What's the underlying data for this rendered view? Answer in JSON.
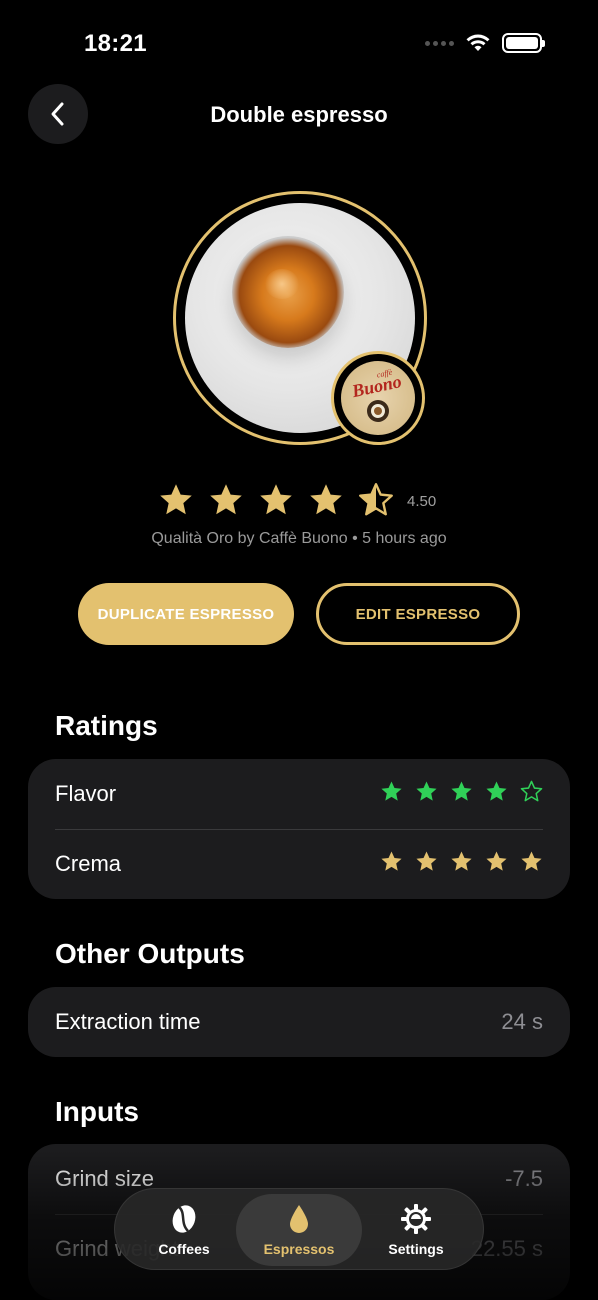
{
  "status_bar": {
    "time": "18:21"
  },
  "header": {
    "title": "Double espresso"
  },
  "hero": {
    "brand_logo_text": "caffè Buono"
  },
  "summary": {
    "rating": 4.5,
    "rating_label": "4.50",
    "subtitle": "Qualità Oro by Caffè Buono • 5 hours ago"
  },
  "actions": {
    "duplicate_label": "DUPLICATE ESPRESSO",
    "edit_label": "EDIT ESPRESSO"
  },
  "ratings_section": {
    "title": "Ratings",
    "items": [
      {
        "label": "Flavor",
        "stars": 4,
        "color": "#30d158"
      },
      {
        "label": "Crema",
        "stars": 5,
        "color": "#e3c16f"
      }
    ]
  },
  "outputs_section": {
    "title": "Other Outputs",
    "items": [
      {
        "label": "Extraction time",
        "value": "24 s"
      }
    ]
  },
  "inputs_section": {
    "title": "Inputs",
    "items": [
      {
        "label": "Grind size",
        "value": "-7.5"
      },
      {
        "label": "Grind weight",
        "value": "22.55 s"
      }
    ]
  },
  "tab_bar": {
    "tabs": [
      {
        "label": "Coffees",
        "icon": "coffee-bean-icon"
      },
      {
        "label": "Espressos",
        "icon": "drop-icon",
        "active": true
      },
      {
        "label": "Settings",
        "icon": "gear-icon"
      }
    ]
  },
  "colors": {
    "accent": "#e3c16f",
    "flavor_green": "#30d158",
    "card": "#1c1c1e"
  }
}
